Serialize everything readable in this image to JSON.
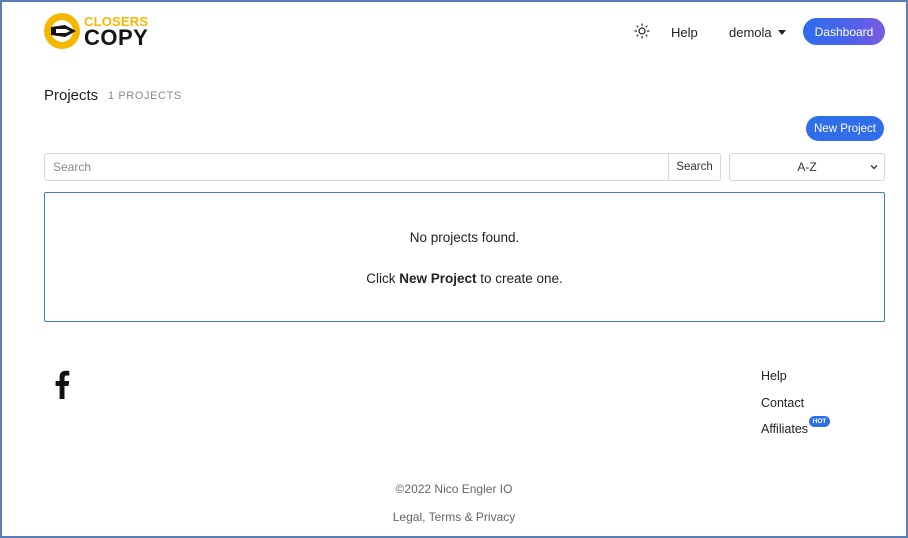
{
  "brand": {
    "name_top": "CLOSERS",
    "name_bottom": "COPY",
    "colors": {
      "yellow": "#f5b800",
      "dark": "#161616"
    }
  },
  "nav": {
    "theme_icon": "sun-icon",
    "help_label": "Help",
    "user_label": "demola",
    "dashboard_label": "Dashboard"
  },
  "projects": {
    "title": "Projects",
    "count_label": "1 PROJECTS",
    "new_project_label": "New Project",
    "search": {
      "placeholder": "Search",
      "value": "",
      "button_label": "Search"
    },
    "sort": {
      "selected": "A-Z"
    },
    "empty": {
      "line1": "No projects found.",
      "line2_prefix": "Click ",
      "line2_bold": "New Project",
      "line2_suffix": " to create one."
    }
  },
  "footer": {
    "social_icon": "facebook-icon",
    "links": [
      "Help",
      "Contact",
      "Affiliates"
    ],
    "hot_badge": "HOT",
    "copyright": "©2022 Nico Engler IO",
    "legal": "Legal, Terms & Privacy"
  },
  "colors": {
    "accent": "#2f6ee8",
    "box_border": "#3f7fb3"
  }
}
